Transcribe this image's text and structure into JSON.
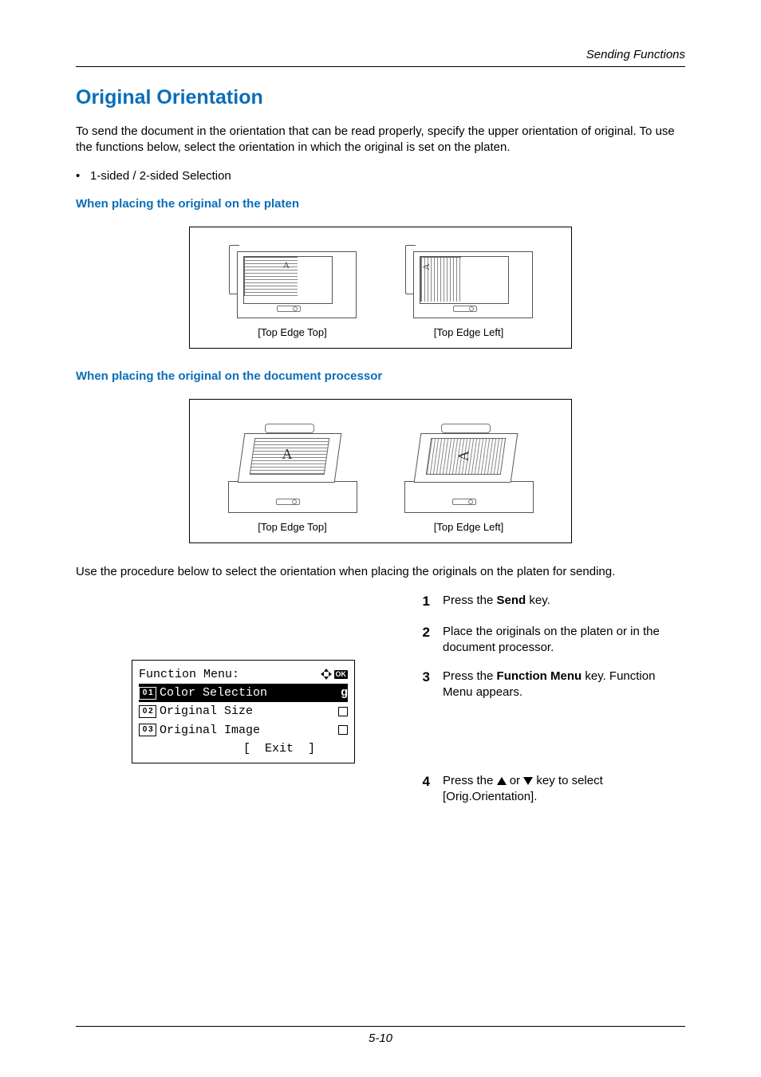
{
  "running_head": "Sending Functions",
  "h1": "Original Orientation",
  "intro": "To send the document in the orientation that can be read properly, specify the upper orientation of original. To use the functions below, select the orientation in which the original is set on the platen.",
  "bullet1": "1-sided / 2-sided Selection",
  "h2a": "When placing the original on the platen",
  "h2b": "When placing the original on the document processor",
  "caption_top": "[Top Edge Top]",
  "caption_left": "[Top Edge Left]",
  "after_figs": "Use the procedure below to select the orientation when placing the originals on the platen for sending.",
  "steps": {
    "s1": {
      "num": "1",
      "text_a": "Press the ",
      "bold": "Send",
      "text_b": " key."
    },
    "s2": {
      "num": "2",
      "text": "Place the originals on the platen or in the document processor."
    },
    "s3": {
      "num": "3",
      "text_a": "Press the ",
      "bold": "Function Menu",
      "text_b": " key. Function Menu appears."
    },
    "s4": {
      "num": "4",
      "text_a": "Press the ",
      "text_b": " or ",
      "text_c": " key to select [Orig.Orientation]."
    }
  },
  "lcd": {
    "title": "Function Menu:",
    "row1_num": "0 1",
    "row1_text": "Color Selection",
    "row2_num": "0 2",
    "row2_text": "Original Size",
    "row3_num": "0 3",
    "row3_text": "Original Image",
    "exit_row": "[  Exit  ]",
    "ok": "OK"
  },
  "page_number": "5-10",
  "letterA": "A"
}
